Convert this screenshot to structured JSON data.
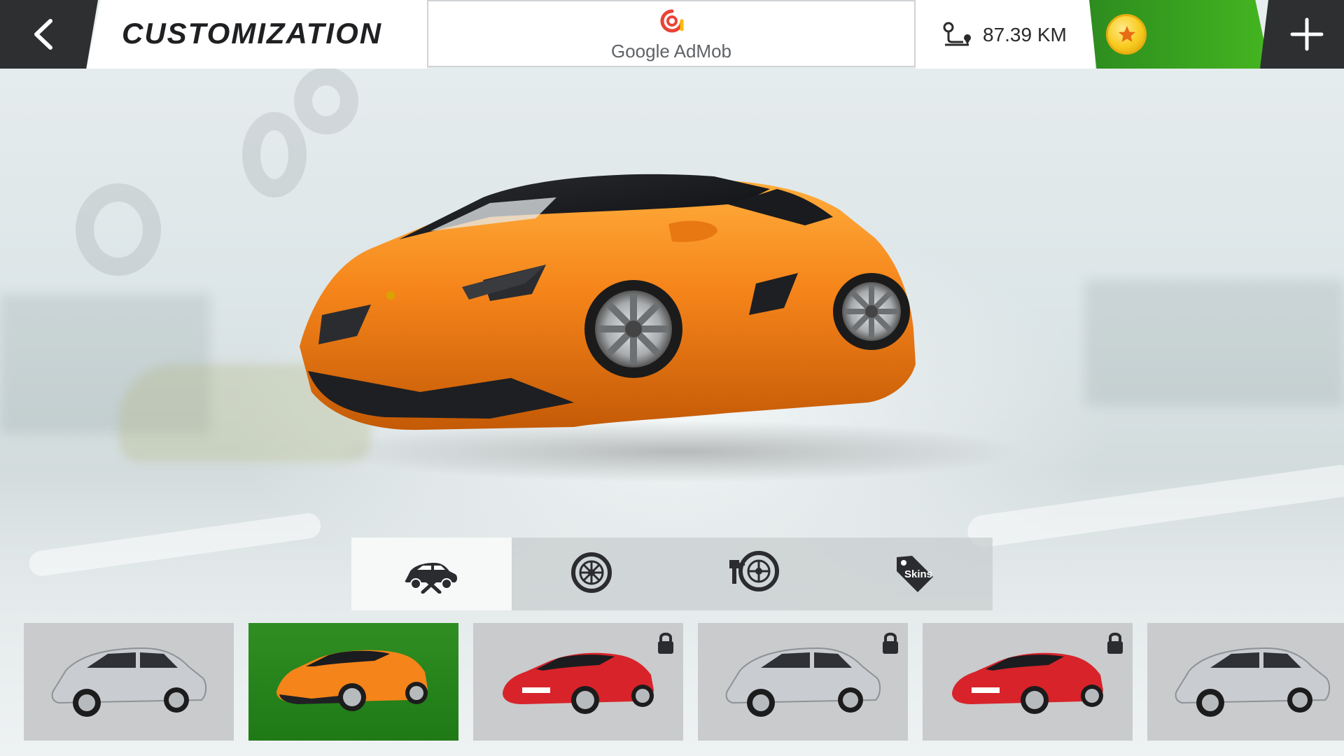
{
  "header": {
    "title": "CUSTOMIZATION",
    "ad_label": "Google AdMob",
    "distance": "87.39 KM",
    "coins": ""
  },
  "icons": {
    "back": "chevron-left-icon",
    "distance": "route-icon",
    "coin": "coin-star-icon",
    "add": "plus-icon"
  },
  "colors": {
    "accent_green": "#3aa51f",
    "dark_button": "#2e2f31",
    "hero_car": "#f5841a",
    "coin_gold": "#f8cb1f"
  },
  "tabs": [
    {
      "name": "body-upgrade",
      "label": "",
      "active": true
    },
    {
      "name": "wheels",
      "label": "",
      "active": false
    },
    {
      "name": "paint-wheels",
      "label": "",
      "active": false
    },
    {
      "name": "skins",
      "label": "Skins",
      "active": false
    }
  ],
  "cars": [
    {
      "model": "silver-sedan",
      "color": "#c9ccd0",
      "locked": false,
      "selected": false
    },
    {
      "model": "orange-supercar",
      "color": "#f5841a",
      "locked": false,
      "selected": true
    },
    {
      "model": "red-sports-coupe",
      "color": "#d8232a",
      "locked": true,
      "selected": false
    },
    {
      "model": "silver-sedan",
      "color": "#c9ccd0",
      "locked": true,
      "selected": false
    },
    {
      "model": "red-sports-coupe",
      "color": "#d8232a",
      "locked": true,
      "selected": false
    },
    {
      "model": "silver-sedan",
      "color": "#c9ccd0",
      "locked": false,
      "selected": false
    }
  ]
}
